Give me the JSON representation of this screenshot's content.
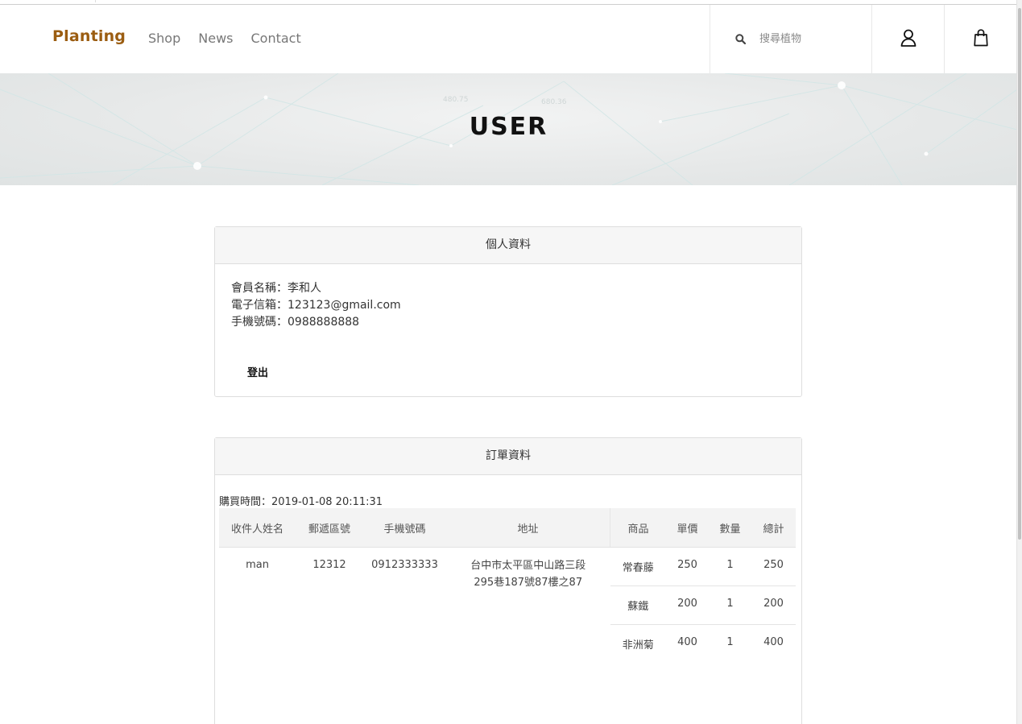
{
  "header": {
    "logo": "Planting",
    "nav": [
      {
        "label": "Shop"
      },
      {
        "label": "News"
      },
      {
        "label": "Contact"
      }
    ],
    "search": {
      "placeholder": "搜尋植物"
    }
  },
  "banner": {
    "title": "USER",
    "bg_numbers": [
      "480.75",
      "680.36"
    ]
  },
  "profile": {
    "heading": "個人資料",
    "name_line": "會員名稱：李和人",
    "email_line": "電子信箱：123123@gmail.com",
    "phone_line": "手機號碼：0988888888",
    "logout_label": "登出"
  },
  "orders": {
    "heading": "訂單資料",
    "purchase_time": "購買時間：2019-01-08 20:11:31",
    "columns": [
      "收件人姓名",
      "郵遞區號",
      "手機號碼",
      "地址",
      "商品",
      "單價",
      "數量",
      "總計"
    ],
    "recipient": {
      "name": "man",
      "zip": "12312",
      "phone": "0912333333",
      "address_line1": "台中市太平區中山路三段",
      "address_line2": "295巷187號87樓之87"
    },
    "items": [
      {
        "name": "常春藤",
        "price": "250",
        "qty": "1",
        "total": "250"
      },
      {
        "name": "蘇鐵",
        "price": "200",
        "qty": "1",
        "total": "200"
      },
      {
        "name": "非洲菊",
        "price": "400",
        "qty": "1",
        "total": "400"
      }
    ]
  },
  "colors": {
    "logo": "#9b5d11",
    "nav": "#777777",
    "panel_head_bg": "#f6f6f6"
  },
  "icons": [
    "search-icon",
    "user-icon",
    "shopping-bag-icon"
  ]
}
